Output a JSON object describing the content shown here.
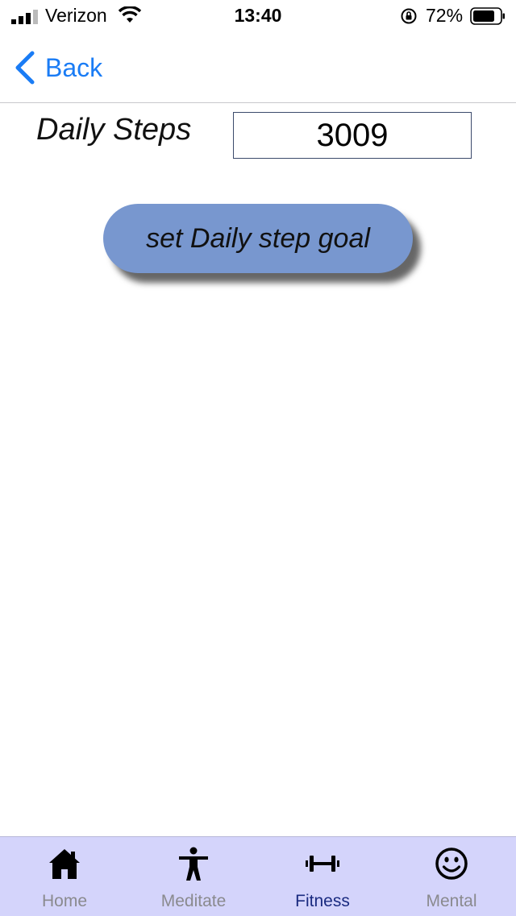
{
  "status_bar": {
    "carrier": "Verizon",
    "time": "13:40",
    "battery": "72%",
    "icons": [
      "signal-icon",
      "wifi-icon",
      "orientation-lock-icon",
      "battery-icon"
    ]
  },
  "nav": {
    "back_label": "Back",
    "back_icon": "chevron-left-icon"
  },
  "content": {
    "daily_steps_label": "Daily Steps",
    "steps_value": "3009",
    "goal_button_label": "set Daily step goal"
  },
  "tabs": [
    {
      "label": "Home",
      "icon": "house-icon"
    },
    {
      "label": "Meditate",
      "icon": "person-icon"
    },
    {
      "label": "Fitness",
      "icon": "dumbbell-icon"
    },
    {
      "label": "Mental",
      "icon": "smiley-icon"
    }
  ],
  "colors": {
    "accent": "#1a7cf5",
    "button": "#7897cf",
    "tab_bar": "#d4d4fb",
    "tab_active": "#1a2b80",
    "tab_inactive": "#8a8a8e"
  }
}
